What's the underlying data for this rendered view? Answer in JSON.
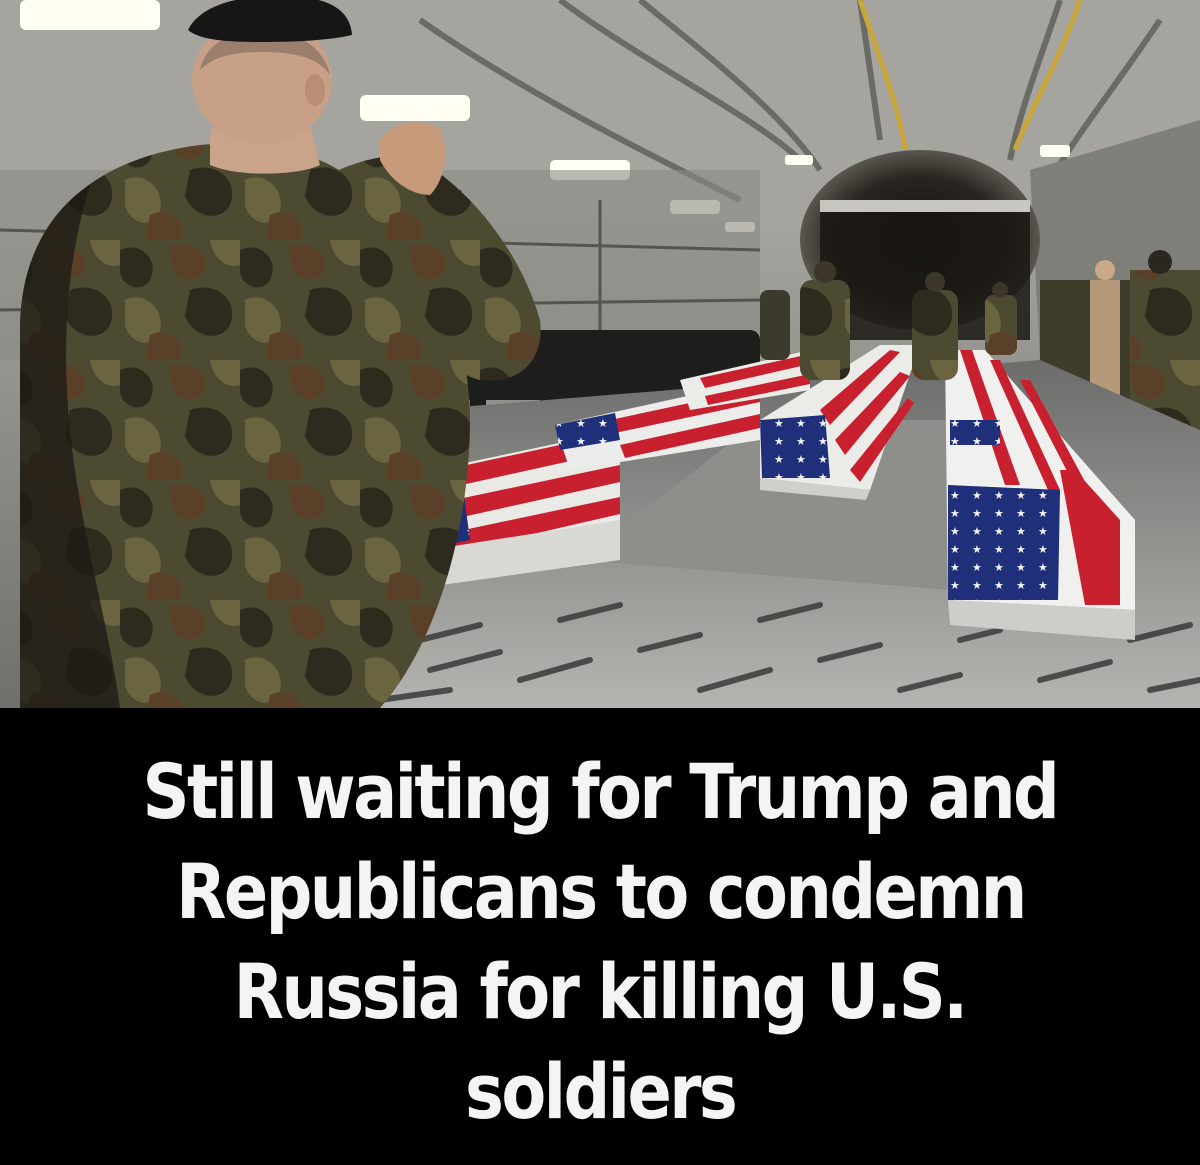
{
  "photo": {
    "subject": "military-honor-guard-salute-flag-draped-caskets",
    "colors": {
      "flag_red": "#c8202e",
      "flag_blue": "#1f2f7a",
      "flag_white": "#f2f2f2",
      "camo_dark": "#2e2a1e",
      "camo_mid": "#4d4a32",
      "camo_brown": "#5a4028",
      "hull": "#8f908c",
      "floor": "#9a9a96"
    }
  },
  "caption": {
    "lines": [
      "Still waiting for Trump and",
      "Republicans to condemn",
      "Russia for killing U.S.",
      "soldiers"
    ],
    "text_color": "#f4f4f4",
    "background": "#000000"
  }
}
